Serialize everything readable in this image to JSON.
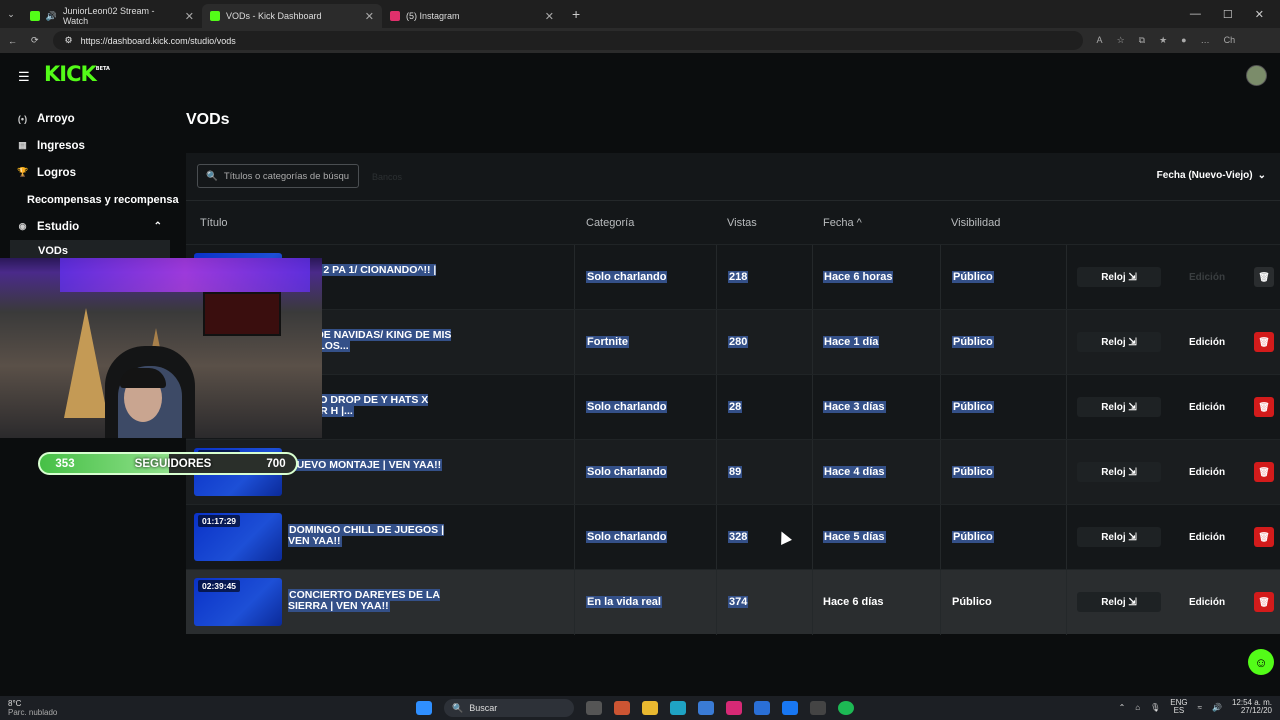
{
  "browser": {
    "tabs": [
      {
        "title": "JuniorLeon02 Stream - Watch",
        "color": "#53fc18"
      },
      {
        "title": "VODs - Kick Dashboard",
        "color": "#53fc18"
      },
      {
        "title": "(5) Instagram",
        "color": "#e1306c"
      }
    ],
    "url": "https://dashboard.kick.com/studio/vods",
    "profile_label": "Ch"
  },
  "app": {
    "logo": "KICK",
    "logo_badge": "BETA"
  },
  "sidebar": {
    "items": [
      {
        "label": "Arroyo",
        "icon": "radio-icon"
      },
      {
        "label": "Ingresos",
        "icon": "chart-icon"
      },
      {
        "label": "Logros",
        "icon": "trophy-icon"
      },
      {
        "label": "Recompensas y recompensa",
        "icon": ""
      },
      {
        "label": "Estudio",
        "icon": "studio-icon"
      },
      {
        "label": "VODs",
        "icon": ""
      }
    ]
  },
  "page": {
    "title": "VODs",
    "search_placeholder": "Títulos o categorías de búsqu",
    "ghost_text": "Bancos",
    "sort_label": "Fecha (Nuevo-Viejo)"
  },
  "table": {
    "headers": {
      "title": "Título",
      "category": "Categoría",
      "views": "Vistas",
      "date": "Fecha ^",
      "visibility": "Visibilidad"
    },
    "rows": [
      {
        "duration": "",
        "title": "ES DE 2 PA 1/ CIONANDO^!! | VEN...",
        "category": "Solo charlando",
        "views": "218",
        "date": "Hace 6 horas",
        "visibility": "Público",
        "reloj": "Reloj ⇲",
        "edit": "Edición"
      },
      {
        "duration": "",
        "title": "CIAL DE NAVIDAS/ KING DE MIS REGALOS...",
        "category": "Fortnite",
        "views": "280",
        "date": "Hace 1 día",
        "visibility": "Público",
        "reloj": "Reloj ⇲",
        "edit": "Edición"
      },
      {
        "duration": "",
        "title": "RANDO DROP DE Y HATS X JUNIOR H |...",
        "category": "Solo charlando",
        "views": "28",
        "date": "Hace 3 días",
        "visibility": "Público",
        "reloj": "Reloj ⇲",
        "edit": "Edición"
      },
      {
        "duration": "03:01:06",
        "title": "NUEVO MONTAJE | VEN YAA!!",
        "category": "Solo charlando",
        "views": "89",
        "date": "Hace 4 días",
        "visibility": "Público",
        "reloj": "Reloj ⇲",
        "edit": "Edición"
      },
      {
        "duration": "01:17:29",
        "title": "DOMINGO CHILL DE JUEGOS | VEN YAA!!",
        "category": "Solo charlando",
        "views": "328",
        "date": "Hace 5 días",
        "visibility": "Público",
        "reloj": "Reloj ⇲",
        "edit": "Edición"
      },
      {
        "duration": "02:39:45",
        "title": "CONCIERTO DAREYES DE LA SIERRA | VEN YAA!!",
        "category": "En la vida real",
        "views": "374",
        "date": "Hace 6 días",
        "visibility": "Público",
        "reloj": "Reloj ⇲",
        "edit": "Edición"
      }
    ]
  },
  "overlay": {
    "followers_current": "353",
    "followers_label": "SEGUIDORES",
    "followers_goal": "700",
    "followers_progress": 0.504
  },
  "taskbar": {
    "temp": "8°C",
    "weather": "Parc. nublado",
    "search": "Buscar",
    "lang": "ENG",
    "region": "ES",
    "time": "12:54 a. m.",
    "date": "27/12/20"
  }
}
